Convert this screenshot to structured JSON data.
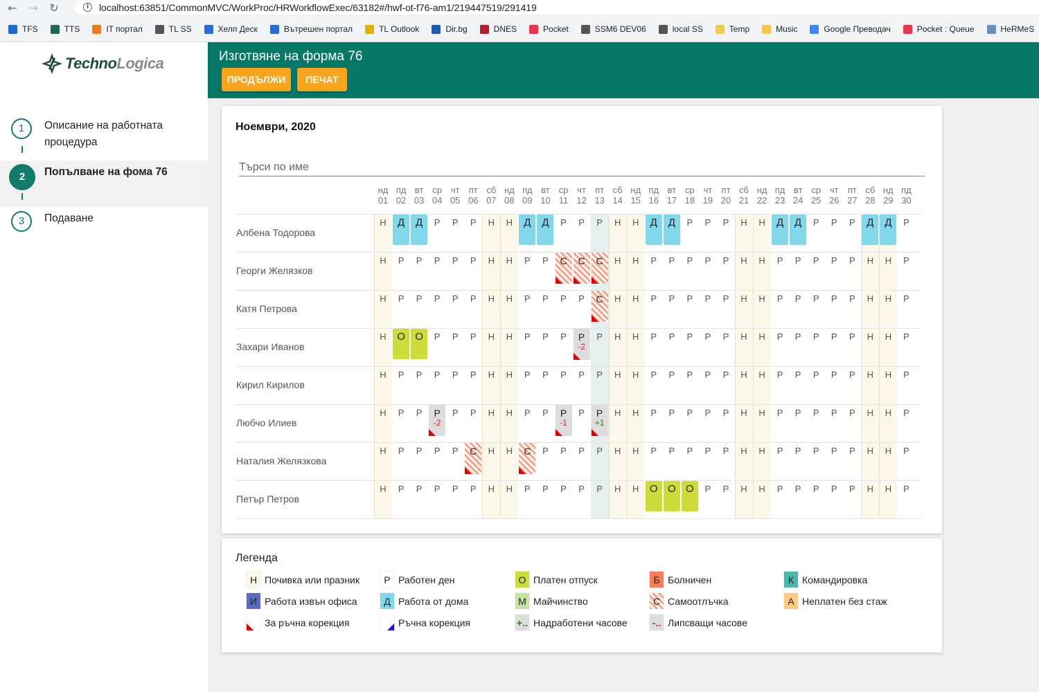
{
  "browser": {
    "url": "localhost:63851/CommonMVC/WorkProc/HRWorkflowExec/63182#/hwf-ot-f76-am1/219447519/291419",
    "bookmarks": [
      {
        "label": "TFS",
        "icon": "tfs-icon",
        "color": "#1b6ac9"
      },
      {
        "label": "TTS",
        "icon": "tts-icon",
        "color": "#1e6b55"
      },
      {
        "label": "IT портал",
        "icon": "it-portal-icon",
        "color": "#f07a1a"
      },
      {
        "label": "TL SS",
        "icon": "globe-icon",
        "color": "#555555"
      },
      {
        "label": "Хелп Деск",
        "icon": "check-icon",
        "color": "#2a6bd8"
      },
      {
        "label": "Вътрешен портал",
        "icon": "check-icon",
        "color": "#2a6bd8"
      },
      {
        "label": "TL Outlook",
        "icon": "outlook-icon",
        "color": "#e0b000"
      },
      {
        "label": "Dir.bg",
        "icon": "dir-icon",
        "color": "#1b5bb5"
      },
      {
        "label": "DNES",
        "icon": "dnes-icon",
        "color": "#b01e2a"
      },
      {
        "label": "Pocket",
        "icon": "pocket-icon",
        "color": "#e8364f"
      },
      {
        "label": "SSM6 DEV06",
        "icon": "globe-icon",
        "color": "#555555"
      },
      {
        "label": "local SS",
        "icon": "globe-icon",
        "color": "#555555"
      },
      {
        "label": "Temp",
        "icon": "folder-icon",
        "color": "#f2c94c"
      },
      {
        "label": "Music",
        "icon": "folder-icon",
        "color": "#f2c94c"
      },
      {
        "label": "Google Преводач",
        "icon": "translate-icon",
        "color": "#4285f4"
      },
      {
        "label": "Pocket : Queue",
        "icon": "pocket-icon",
        "color": "#e8364f"
      },
      {
        "label": "HeRMeS",
        "icon": "page-icon",
        "color": "#6a8fc7"
      }
    ]
  },
  "logo": {
    "part1": "Techno",
    "part2": "Logica"
  },
  "steps": [
    {
      "num": "1",
      "label": "Описание на работната процедура"
    },
    {
      "num": "2",
      "label": "Попълване на фома 76"
    },
    {
      "num": "3",
      "label": "Подаване"
    }
  ],
  "header": {
    "title": "Изготвяне на форма 76",
    "continue_label": "ПРОДЪЛЖИ",
    "print_label": "ПЕЧАТ"
  },
  "month": "Ноември, 2020",
  "search": {
    "placeholder": "Търси по име"
  },
  "days": [
    {
      "dow": "нд",
      "num": "01",
      "weekend": true
    },
    {
      "dow": "пд",
      "num": "02"
    },
    {
      "dow": "вт",
      "num": "03"
    },
    {
      "dow": "ср",
      "num": "04"
    },
    {
      "dow": "чт",
      "num": "05"
    },
    {
      "dow": "пт",
      "num": "06"
    },
    {
      "dow": "сб",
      "num": "07",
      "weekend": true
    },
    {
      "dow": "нд",
      "num": "08",
      "weekend": true
    },
    {
      "dow": "пд",
      "num": "09"
    },
    {
      "dow": "вт",
      "num": "10"
    },
    {
      "dow": "ср",
      "num": "11"
    },
    {
      "dow": "чт",
      "num": "12"
    },
    {
      "dow": "пт",
      "num": "13",
      "selected": true
    },
    {
      "dow": "сб",
      "num": "14",
      "weekend": true
    },
    {
      "dow": "нд",
      "num": "15",
      "weekend": true
    },
    {
      "dow": "пд",
      "num": "16"
    },
    {
      "dow": "вт",
      "num": "17"
    },
    {
      "dow": "ср",
      "num": "18"
    },
    {
      "dow": "чт",
      "num": "19"
    },
    {
      "dow": "пт",
      "num": "20"
    },
    {
      "dow": "сб",
      "num": "21",
      "weekend": true
    },
    {
      "dow": "нд",
      "num": "22",
      "weekend": true
    },
    {
      "dow": "пд",
      "num": "23"
    },
    {
      "dow": "вт",
      "num": "24"
    },
    {
      "dow": "ср",
      "num": "25"
    },
    {
      "dow": "чт",
      "num": "26"
    },
    {
      "dow": "пт",
      "num": "27"
    },
    {
      "dow": "сб",
      "num": "28",
      "weekend": true
    },
    {
      "dow": "нд",
      "num": "29",
      "weekend": true
    },
    {
      "dow": "пд",
      "num": "30"
    }
  ],
  "employees": [
    {
      "name": "Албена Тодорова",
      "days": [
        "Н",
        "Д",
        "Д",
        "Р",
        "Р",
        "Р",
        "Н",
        "Н",
        "Д",
        "Д",
        "Р",
        "Р",
        "Р",
        "Н",
        "Н",
        "Д",
        "Д",
        "Р",
        "Р",
        "Р",
        "Н",
        "Н",
        "Д",
        "Д",
        "Р",
        "Р",
        "Р",
        "Д",
        "Д",
        "Р"
      ]
    },
    {
      "name": "Георги Желязков",
      "days": [
        "Н",
        "Р",
        "Р",
        "Р",
        "Р",
        "Р",
        "Н",
        "Н",
        "Р",
        "Р",
        {
          "v": "С",
          "t": "S",
          "flag": true
        },
        {
          "v": "С",
          "t": "S",
          "flag": true
        },
        {
          "v": "С",
          "t": "S",
          "flag": true
        },
        "Н",
        "Н",
        "Р",
        "Р",
        "Р",
        "Р",
        "Р",
        "Н",
        "Н",
        "Р",
        "Р",
        "Р",
        "Р",
        "Р",
        "Н",
        "Н",
        "Р"
      ]
    },
    {
      "name": "Катя Петрова",
      "days": [
        "Н",
        "Р",
        "Р",
        "Р",
        "Р",
        "Р",
        "Н",
        "Н",
        "Р",
        "Р",
        "Р",
        "Р",
        {
          "v": "С",
          "t": "S",
          "flag": true
        },
        "Н",
        "Н",
        "Р",
        "Р",
        "Р",
        "Р",
        "Р",
        "Н",
        "Н",
        "Р",
        "Р",
        "Р",
        "Р",
        "Р",
        "Н",
        "Н",
        "Р"
      ]
    },
    {
      "name": "Захари Иванов",
      "days": [
        "Н",
        "О",
        "О",
        "Р",
        "Р",
        "Р",
        "Н",
        "Н",
        "Р",
        "Р",
        "Р",
        {
          "v": "Р",
          "t": "G",
          "adj": "-2",
          "flag": true
        },
        "Р",
        "Н",
        "Н",
        "Р",
        "Р",
        "Р",
        "Р",
        "Р",
        "Н",
        "Н",
        "Р",
        "Р",
        "Р",
        "Р",
        "Р",
        "Н",
        "Н",
        "Р"
      ]
    },
    {
      "name": "Кирил Кирилов",
      "days": [
        "Н",
        "Р",
        "Р",
        "Р",
        "Р",
        "Р",
        "Н",
        "Н",
        "Р",
        "Р",
        "Р",
        "Р",
        "Р",
        "Н",
        "Н",
        "Р",
        "Р",
        "Р",
        "Р",
        "Р",
        "Н",
        "Н",
        "Р",
        "Р",
        "Р",
        "Р",
        "Р",
        "Н",
        "Н",
        "Р"
      ]
    },
    {
      "name": "Любчо Илиев",
      "days": [
        "Н",
        "Р",
        "Р",
        {
          "v": "Р",
          "t": "G",
          "adj": "-2",
          "flag": true
        },
        "Р",
        "Р",
        "Н",
        "Н",
        "Р",
        "Р",
        {
          "v": "Р",
          "t": "G",
          "adj": "-1",
          "flag": true
        },
        "Р",
        {
          "v": "Р",
          "t": "G",
          "adj": "+1",
          "flag": true
        },
        "Н",
        "Н",
        "Р",
        "Р",
        "Р",
        "Р",
        "Р",
        "Н",
        "Н",
        "Р",
        "Р",
        "Р",
        "Р",
        "Р",
        "Н",
        "Н",
        "Р"
      ]
    },
    {
      "name": "Наталия Желязкова",
      "days": [
        "Н",
        "Р",
        "Р",
        "Р",
        "Р",
        {
          "v": "С",
          "t": "S",
          "flag": true
        },
        "Н",
        "Н",
        {
          "v": "С",
          "t": "S",
          "flag": true
        },
        "Р",
        "Р",
        "Р",
        "Р",
        "Н",
        "Н",
        "Р",
        "Р",
        "Р",
        "Р",
        "Р",
        "Н",
        "Н",
        "Р",
        "Р",
        "Р",
        "Р",
        "Р",
        "Н",
        "Н",
        "Р"
      ]
    },
    {
      "name": "Петър Петров",
      "days": [
        "Н",
        "Р",
        "Р",
        "Р",
        "Р",
        "Р",
        "Н",
        "Н",
        "Р",
        "Р",
        "Р",
        "Р",
        "Р",
        "Н",
        "Н",
        "О",
        "О",
        "О",
        "Р",
        "Р",
        "Н",
        "Н",
        "Р",
        "Р",
        "Р",
        "Р",
        "Р",
        "Н",
        "Н",
        "Р"
      ]
    }
  ],
  "legend": {
    "title": "Легенда",
    "items": [
      {
        "code": "Н",
        "label": "Почивка или празник",
        "bg": "#fbf8ea"
      },
      {
        "code": "Р",
        "label": "Работен ден",
        "bg": "#ffffff"
      },
      {
        "code": "О",
        "label": "Платен отпуск",
        "bg": "#cddc39"
      },
      {
        "code": "Б",
        "label": "Болничен",
        "bg": "#f77b57"
      },
      {
        "code": "К",
        "label": "Командировка",
        "bg": "#4db6ac"
      },
      {
        "code": "И",
        "label": "Работа извън офиса",
        "bg": "#5c6bc0"
      },
      {
        "code": "Д",
        "label": "Работа от дома",
        "bg": "#80d8ea"
      },
      {
        "code": "М",
        "label": "Майчинство",
        "bg": "#c5e1a5"
      },
      {
        "code": "С",
        "label": "Самоотлъчка",
        "bg": "stripes"
      },
      {
        "code": "А",
        "label": "Неплатен без стаж",
        "bg": "#ffcc80"
      },
      {
        "code": "",
        "label": "За ръчна корекция",
        "bg": "#ffffff",
        "flag": "red"
      },
      {
        "code": "",
        "label": "Ръчна корекция",
        "bg": "#ffffff",
        "flag": "blue"
      },
      {
        "code": "+..",
        "label": "Надработени часове",
        "bg": "#dddddd",
        "codeColor": "#1a8a1a"
      },
      {
        "code": "-..",
        "label": "Липсващи часове",
        "bg": "#dddddd",
        "codeColor": "#e02020"
      }
    ]
  }
}
